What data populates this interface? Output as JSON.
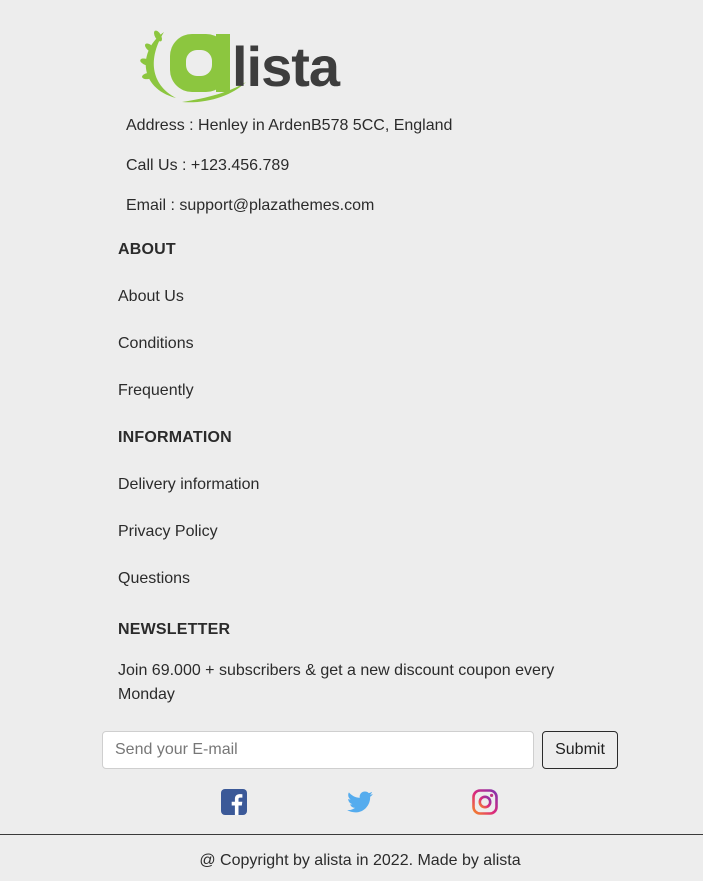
{
  "brand": {
    "logo_text": "alista",
    "colors": {
      "green": "#8cc63f",
      "dark": "#3d3d3d"
    }
  },
  "contact": {
    "address": "Address : Henley in ArdenB578 5CC, England",
    "phone": "Call Us : +123.456.789",
    "email": "Email : support@plazathemes.com"
  },
  "about": {
    "heading": "ABOUT",
    "links": [
      "About Us",
      "Conditions",
      "Frequently"
    ]
  },
  "information": {
    "heading": "INFORMATION",
    "links": [
      "Delivery information",
      "Privacy Policy",
      "Questions"
    ]
  },
  "newsletter": {
    "heading": "NEWSLETTER",
    "text": "Join 69.000 + subscribers & get a new discount coupon every Monday",
    "input_placeholder": "Send your E-mail",
    "submit_label": "Submit"
  },
  "social": [
    {
      "name": "facebook-icon",
      "color": "#3b5998"
    },
    {
      "name": "twitter-icon",
      "color": "#55acee"
    },
    {
      "name": "instagram-icon",
      "color": "#c13584"
    }
  ],
  "footer": {
    "copyright": "@ Copyright by alista in 2022. Made by alista"
  }
}
